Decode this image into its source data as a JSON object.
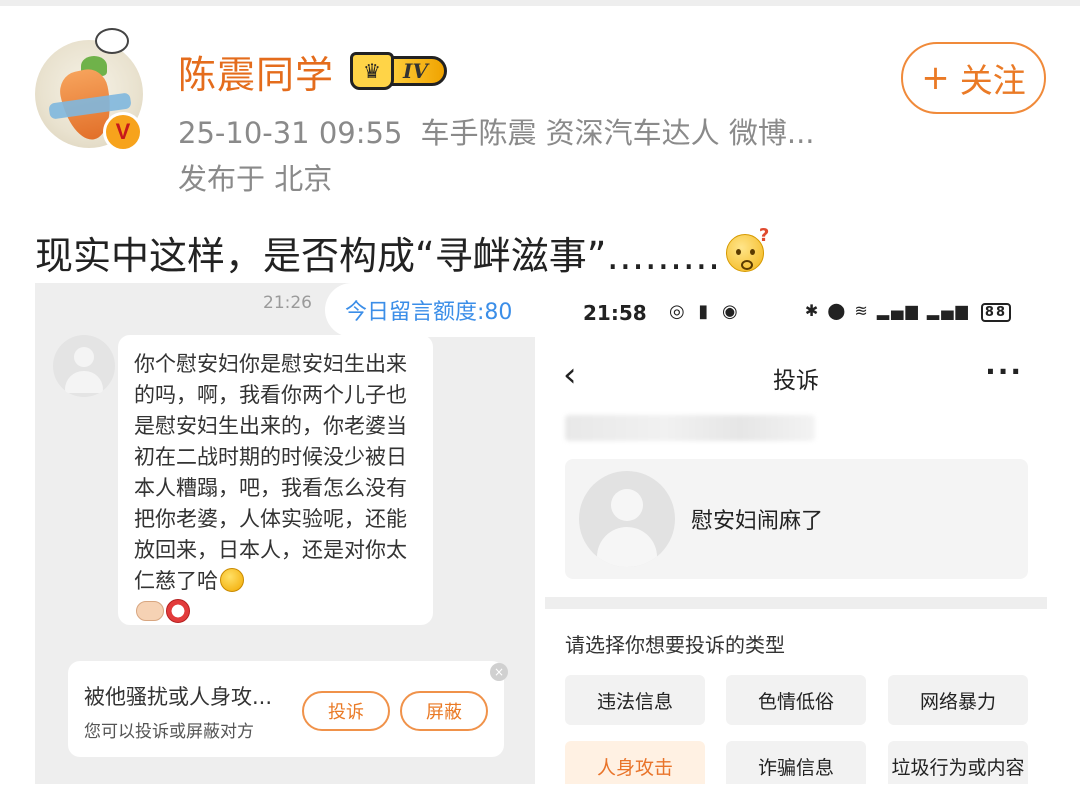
{
  "post": {
    "username": "陈震同学",
    "level_badge": "IV",
    "verified_badge": "V",
    "timestamp": "25-10-31 09:55",
    "source": "车手陈震 资深汽车达人 微博...",
    "location": "发布于 北京",
    "follow_label": "关注",
    "follow_icon": "+",
    "text": "现实中这样，是否构成“寻衅滋事”………",
    "emoji": "thinking-face-icon"
  },
  "left_screenshot": {
    "time": "21:26",
    "quota": "今日留言额度:80",
    "message": "你个慰安妇你是慰安妇生出来的吗，啊，我看你两个儿子也是慰安妇生出来的，你老婆当初在二战时期的时候没少被日本人糟蹋，吧，我看怎么没有把你老婆，人体实验呢，还能放回来，日本人，还是对你太仁慈了哈",
    "harass_title": "被他骚扰或人身攻...",
    "harass_sub": "您可以投诉或屏蔽对方",
    "report_label": "投诉",
    "block_label": "屏蔽",
    "close_icon": "×"
  },
  "right_screenshot": {
    "status_time": "21:58",
    "battery": "88",
    "nav_title": "投诉",
    "back_icon": "‹",
    "more_icon": "···",
    "target_text": "慰安妇闹麻了",
    "choose_label": "请选择你想要投诉的类型",
    "categories": [
      {
        "label": "违法信息"
      },
      {
        "label": "色情低俗"
      },
      {
        "label": "网络暴力"
      },
      {
        "label": "人身攻击"
      },
      {
        "label": "诈骗信息"
      },
      {
        "label": "垃圾行为或内容"
      }
    ]
  },
  "colors": {
    "accent": "#ea7a26",
    "username": "#e46c1c",
    "link_blue": "#3b8ee8",
    "active_bg": "#fff1e3"
  }
}
